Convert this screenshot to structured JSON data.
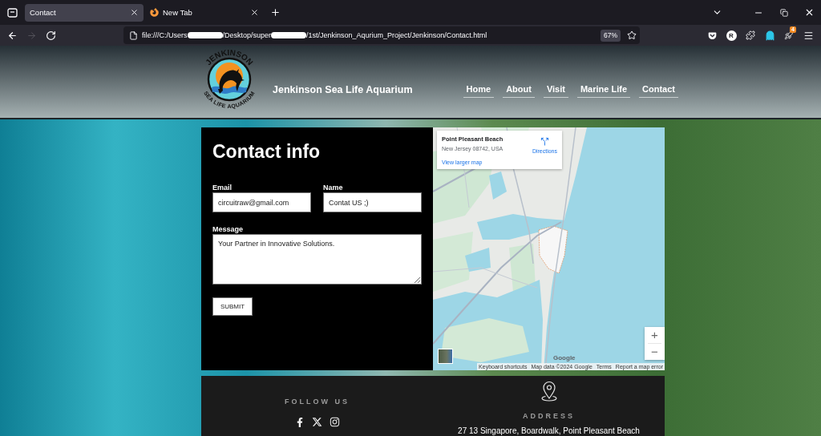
{
  "browser": {
    "tabs": [
      {
        "title": "Contact",
        "selected": true,
        "has_icon": false
      },
      {
        "title": "New Tab",
        "selected": false,
        "has_icon": true
      }
    ],
    "nav_buttons": [
      {
        "kind": "back",
        "disabled": false
      },
      {
        "kind": "forward",
        "disabled": true
      },
      {
        "kind": "reload",
        "disabled": false
      }
    ],
    "address_bar": {
      "segments": [
        {
          "text": "file:///C:/Users",
          "redacted_after": true
        },
        {
          "text": "/Desktop/super",
          "redacted_after": true
        },
        {
          "text": "/1st/Jenkinson_Aqurium_Project/Jenkinson/Contact.html",
          "redacted_after": false
        }
      ],
      "zoom": "67%"
    },
    "account_initial": "R",
    "extension_badge": "4"
  },
  "header": {
    "logo": {
      "top_text": "JENKINSON",
      "bottom_text": "SEA LIFE AQUARIUM"
    },
    "site_title": "Jenkinson Sea Life Aquarium",
    "nav": [
      "Home",
      "About",
      "Visit",
      "Marine Life",
      "Contact"
    ]
  },
  "contact_form": {
    "heading": "Contact info",
    "fields": [
      {
        "kind": "input",
        "label": "Email",
        "value": "circuitraw@gmail.com"
      },
      {
        "kind": "input",
        "label": "Name",
        "value": "Contat US ;)"
      },
      {
        "kind": "textarea",
        "label": "Message",
        "value": "Your Partner in Innovative Solutions."
      }
    ],
    "submit": "SUBMIT"
  },
  "map": {
    "place": {
      "name": "Point Pleasant Beach",
      "address": "New Jersey 08742, USA",
      "directions": "Directions",
      "larger_map": "View larger map"
    },
    "zoom_in": "+",
    "zoom_out": "−",
    "logo": "Google",
    "attribution": [
      "Keyboard shortcuts",
      "Map data ©2024 Google",
      "Terms",
      "Report a map error"
    ]
  },
  "footer": {
    "follow": {
      "heading": "FOLLOW US"
    },
    "address": {
      "heading": "ADDRESS",
      "text": "27 13 Singapore, Boardwalk, Point Pleasant Beach"
    }
  }
}
